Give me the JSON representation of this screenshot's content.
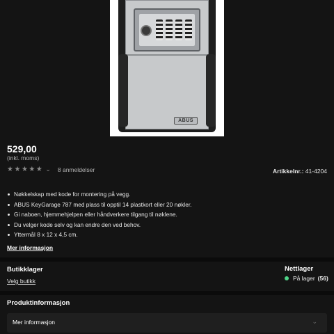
{
  "product": {
    "price": "529,00",
    "vat_note": "(inkl. moms)",
    "rating_stars": 5,
    "reviews": "8 anmeldelser",
    "sku_label": "Artikkelnr.:",
    "sku_value": "41-4204",
    "image_brand": "ABUS"
  },
  "features": [
    "Nøkkelskap med kode for montering på vegg.",
    "ABUS KeyGarage 787 med plass til opptil 14 plastkort eller 20 nøkler.",
    "Gi naboen, hjemmehjelpen eller håndverkere tilgang til nøklene.",
    "Du velger kode selv og kan endre den ved behov.",
    "Yttermål 8 x 12 x 4,5 cm."
  ],
  "more_info_link": "Mer informasjon",
  "store": {
    "title": "Butikklager",
    "select_link": "Velg butikk"
  },
  "online": {
    "title": "Nettlager",
    "stock_label": "På lager",
    "stock_count": "(56)",
    "stock_color": "#4fd488"
  },
  "product_info": {
    "title": "Produktinformasjon",
    "accordion_label": "Mer informasjon"
  },
  "icons": {
    "star": "star-icon",
    "chevron": "chevron-down-icon"
  }
}
